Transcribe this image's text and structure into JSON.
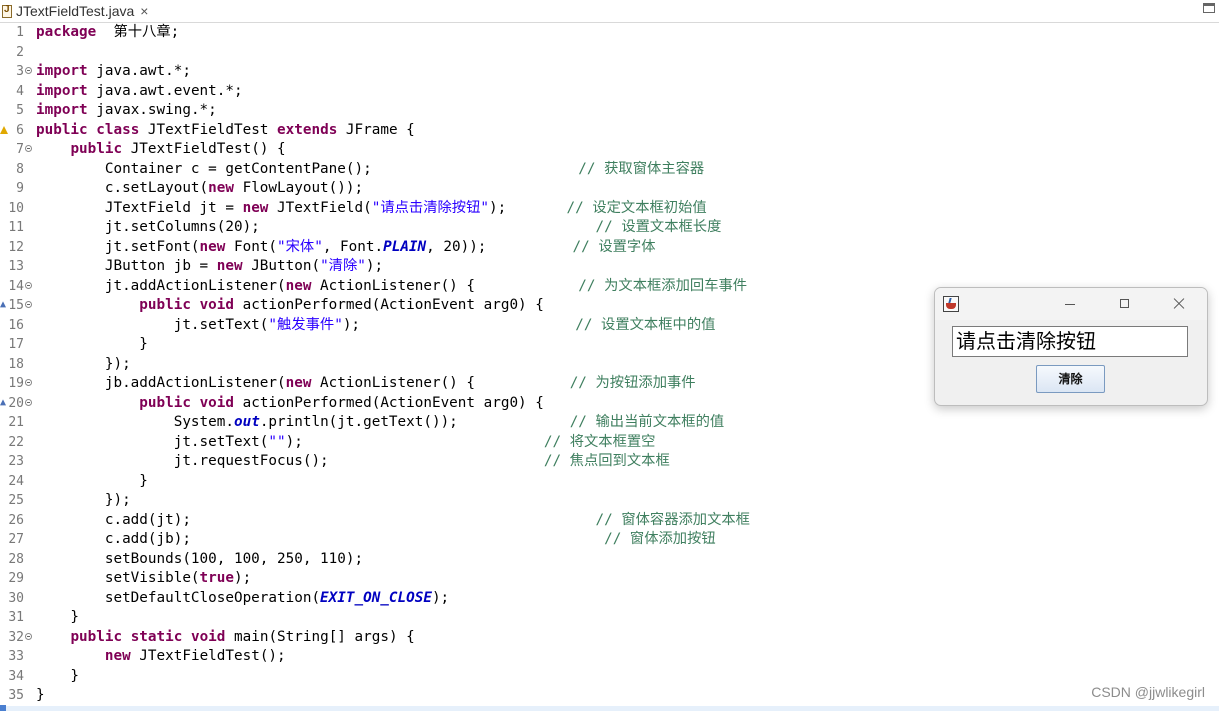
{
  "editor": {
    "tab_title": "JTextFieldTest.java",
    "tab_close": "×"
  },
  "code": [
    {
      "n": "1",
      "t": [
        [
          "kw",
          "package"
        ],
        [
          "",
          "  "
        ],
        [
          "cjk",
          "第十八章"
        ],
        [
          "",
          ";"
        ]
      ]
    },
    {
      "n": "2",
      "t": []
    },
    {
      "n": "3",
      "fold": true,
      "t": [
        [
          "kw",
          "import"
        ],
        [
          "",
          " java.awt.*;"
        ]
      ]
    },
    {
      "n": "4",
      "t": [
        [
          "kw",
          "import"
        ],
        [
          "",
          " java.awt.event.*;"
        ]
      ]
    },
    {
      "n": "5",
      "t": [
        [
          "kw",
          "import"
        ],
        [
          "",
          " javax.swing.*;"
        ]
      ]
    },
    {
      "n": "6",
      "warn": true,
      "t": [
        [
          "kw",
          "public"
        ],
        [
          "",
          " "
        ],
        [
          "kw",
          "class"
        ],
        [
          "",
          " JTextFieldTest "
        ],
        [
          "kw",
          "extends"
        ],
        [
          "",
          " JFrame {"
        ]
      ]
    },
    {
      "n": "7",
      "fold": true,
      "t": [
        [
          "",
          "    "
        ],
        [
          "kw",
          "public"
        ],
        [
          "",
          " JTextFieldTest() {"
        ]
      ]
    },
    {
      "n": "8",
      "t": [
        [
          "",
          "        Container c = getContentPane();                        "
        ],
        [
          "cm",
          "// "
        ],
        [
          "cm cjk",
          "获取窗体主容器"
        ]
      ]
    },
    {
      "n": "9",
      "t": [
        [
          "",
          "        c.setLayout("
        ],
        [
          "kw",
          "new"
        ],
        [
          "",
          " FlowLayout());"
        ]
      ]
    },
    {
      "n": "10",
      "t": [
        [
          "",
          "        JTextField jt = "
        ],
        [
          "kw",
          "new"
        ],
        [
          "",
          " JTextField("
        ],
        [
          "str",
          "\""
        ],
        [
          "str cjk",
          "请点击清除按钮"
        ],
        [
          "str",
          "\""
        ],
        [
          "",
          ");       "
        ],
        [
          "cm",
          "// "
        ],
        [
          "cm cjk",
          "设定文本框初始值"
        ]
      ]
    },
    {
      "n": "11",
      "t": [
        [
          "",
          "        jt.setColumns(20);                                       "
        ],
        [
          "cm",
          "// "
        ],
        [
          "cm cjk",
          "设置文本框长度"
        ]
      ]
    },
    {
      "n": "12",
      "t": [
        [
          "",
          "        jt.setFont("
        ],
        [
          "kw",
          "new"
        ],
        [
          "",
          " Font("
        ],
        [
          "str",
          "\""
        ],
        [
          "str cjk",
          "宋体"
        ],
        [
          "str",
          "\""
        ],
        [
          "",
          ", Font."
        ],
        [
          "fst",
          "PLAIN"
        ],
        [
          "",
          ", 20));          "
        ],
        [
          "cm",
          "// "
        ],
        [
          "cm cjk",
          "设置字体"
        ]
      ]
    },
    {
      "n": "13",
      "t": [
        [
          "",
          "        JButton jb = "
        ],
        [
          "kw",
          "new"
        ],
        [
          "",
          " JButton("
        ],
        [
          "str",
          "\""
        ],
        [
          "str cjk",
          "清除"
        ],
        [
          "str",
          "\""
        ],
        [
          "",
          ");"
        ]
      ]
    },
    {
      "n": "14",
      "fold": true,
      "t": [
        [
          "",
          "        jt.addActionListener("
        ],
        [
          "kw",
          "new"
        ],
        [
          "",
          " ActionListener() {            "
        ],
        [
          "cm",
          "// "
        ],
        [
          "cm cjk",
          "为文本框添加回车事件"
        ]
      ]
    },
    {
      "n": "15",
      "fold": true,
      "override": true,
      "t": [
        [
          "",
          "            "
        ],
        [
          "kw",
          "public"
        ],
        [
          "",
          " "
        ],
        [
          "kw",
          "void"
        ],
        [
          "",
          " actionPerformed(ActionEvent arg0) {"
        ]
      ]
    },
    {
      "n": "16",
      "t": [
        [
          "",
          "                jt.setText("
        ],
        [
          "str",
          "\""
        ],
        [
          "str cjk",
          "触发事件"
        ],
        [
          "str",
          "\""
        ],
        [
          "",
          ");                         "
        ],
        [
          "cm",
          "// "
        ],
        [
          "cm cjk",
          "设置文本框中的值"
        ]
      ]
    },
    {
      "n": "17",
      "t": [
        [
          "",
          "            }"
        ]
      ]
    },
    {
      "n": "18",
      "t": [
        [
          "",
          "        });"
        ]
      ]
    },
    {
      "n": "19",
      "fold": true,
      "t": [
        [
          "",
          "        jb.addActionListener("
        ],
        [
          "kw",
          "new"
        ],
        [
          "",
          " ActionListener() {           "
        ],
        [
          "cm",
          "// "
        ],
        [
          "cm cjk",
          "为按钮添加事件"
        ]
      ]
    },
    {
      "n": "20",
      "fold": true,
      "override": true,
      "t": [
        [
          "",
          "            "
        ],
        [
          "kw",
          "public"
        ],
        [
          "",
          " "
        ],
        [
          "kw",
          "void"
        ],
        [
          "",
          " actionPerformed(ActionEvent arg0) {"
        ]
      ]
    },
    {
      "n": "21",
      "t": [
        [
          "",
          "                System."
        ],
        [
          "fst",
          "out"
        ],
        [
          "",
          ".println(jt.getText());             "
        ],
        [
          "cm",
          "// "
        ],
        [
          "cm cjk",
          "输出当前文本框的值"
        ]
      ]
    },
    {
      "n": "22",
      "t": [
        [
          "",
          "                jt.setText("
        ],
        [
          "str",
          "\"\""
        ],
        [
          "",
          ");                            "
        ],
        [
          "cm",
          "// "
        ],
        [
          "cm cjk",
          "将文本框置空"
        ]
      ]
    },
    {
      "n": "23",
      "t": [
        [
          "",
          "                jt.requestFocus();                         "
        ],
        [
          "cm",
          "// "
        ],
        [
          "cm cjk",
          "焦点回到文本框"
        ]
      ]
    },
    {
      "n": "24",
      "t": [
        [
          "",
          "            }"
        ]
      ]
    },
    {
      "n": "25",
      "t": [
        [
          "",
          "        });"
        ]
      ]
    },
    {
      "n": "26",
      "t": [
        [
          "",
          "        c.add(jt);                                               "
        ],
        [
          "cm",
          "// "
        ],
        [
          "cm cjk",
          "窗体容器添加文本框"
        ]
      ]
    },
    {
      "n": "27",
      "t": [
        [
          "",
          "        c.add(jb);                                                "
        ],
        [
          "cm",
          "// "
        ],
        [
          "cm cjk",
          "窗体添加按钮"
        ]
      ]
    },
    {
      "n": "28",
      "t": [
        [
          "",
          "        setBounds(100, 100, 250, 110);"
        ]
      ]
    },
    {
      "n": "29",
      "t": [
        [
          "",
          "        setVisible("
        ],
        [
          "kw",
          "true"
        ],
        [
          "",
          ");"
        ]
      ]
    },
    {
      "n": "30",
      "t": [
        [
          "",
          "        setDefaultCloseOperation("
        ],
        [
          "fst",
          "EXIT_ON_CLOSE"
        ],
        [
          "",
          ");"
        ]
      ]
    },
    {
      "n": "31",
      "t": [
        [
          "",
          "    }"
        ]
      ]
    },
    {
      "n": "32",
      "fold": true,
      "t": [
        [
          "",
          "    "
        ],
        [
          "kw",
          "public"
        ],
        [
          "",
          " "
        ],
        [
          "kw",
          "static"
        ],
        [
          "",
          " "
        ],
        [
          "kw",
          "void"
        ],
        [
          "",
          " main(String[] args) {"
        ]
      ]
    },
    {
      "n": "33",
      "t": [
        [
          "",
          "        "
        ],
        [
          "kw",
          "new"
        ],
        [
          "",
          " JTextFieldTest();"
        ]
      ]
    },
    {
      "n": "34",
      "t": [
        [
          "",
          "    }"
        ]
      ]
    },
    {
      "n": "35",
      "t": [
        [
          "",
          "}"
        ]
      ]
    }
  ],
  "swing_window": {
    "text_field_value": "请点击清除按钮",
    "button_label": "清除"
  },
  "watermark": "CSDN @jjwlikegirl",
  "colors": {
    "keyword": "#7f0055",
    "string": "#2a00ff",
    "comment": "#3f7f5f",
    "static_field": "#0000c0"
  }
}
